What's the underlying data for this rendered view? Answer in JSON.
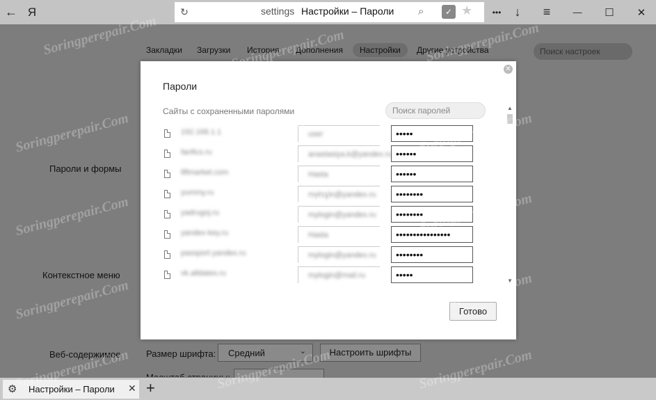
{
  "browser": {
    "back_icon": "←",
    "logo": "Я",
    "url_host": "settings",
    "url_title": "Настройки – Пароли",
    "window_controls": {
      "more": "•••",
      "download": "↓",
      "menu": "≡",
      "minimize": "—",
      "maximize": "☐",
      "close": "✕"
    }
  },
  "settings": {
    "nav_tabs": [
      "Закладки",
      "Загрузки",
      "История",
      "Дополнения",
      "Настройки",
      "Другие устройства"
    ],
    "active_tab": "Настройки",
    "search_placeholder": "Поиск настроек",
    "section_passwords": "Пароли и формы",
    "section_context_menu": "Контекстное меню",
    "section_web_content": "Веб-содержимое",
    "font_size_label": "Размер шрифта:",
    "font_size_value": "Средний",
    "customize_fonts_button": "Настроить шрифты",
    "zoom_label": "Масштаб страницы:"
  },
  "dialog": {
    "title": "Пароли",
    "subtitle": "Сайты с сохраненными паролями",
    "search_placeholder": "Поиск паролей",
    "rows": [
      {
        "site": "192.168.1.1",
        "login": "user",
        "password": "•••••"
      },
      {
        "site": "fanfics.ru",
        "login": "anastasiya.k@yandex.ru",
        "password": "••••••"
      },
      {
        "site": "liftmarket.com",
        "login": "Hasta",
        "password": "••••••"
      },
      {
        "site": "yummy.ru",
        "login": "mylogin@yandex.ru",
        "password": "••••••••"
      },
      {
        "site": "yadrugoj.ru",
        "login": "mylogin@yandex.ru",
        "password": "••••••••"
      },
      {
        "site": "yandex-key.ru",
        "login": "Hasta",
        "password": "••••••••••••••••"
      },
      {
        "site": "passport.yandex.ru",
        "login": "mylogin@yandex.ru",
        "password": "••••••••"
      },
      {
        "site": "vk.alldates.ru",
        "login": "mylogin@mail.ru",
        "password": "•••••"
      }
    ],
    "done_button": "Готово"
  },
  "tabbar": {
    "tab_title": "Настройки – Пароли",
    "close": "✕",
    "new_tab": "+"
  },
  "watermark": "Soringperepair.Com"
}
